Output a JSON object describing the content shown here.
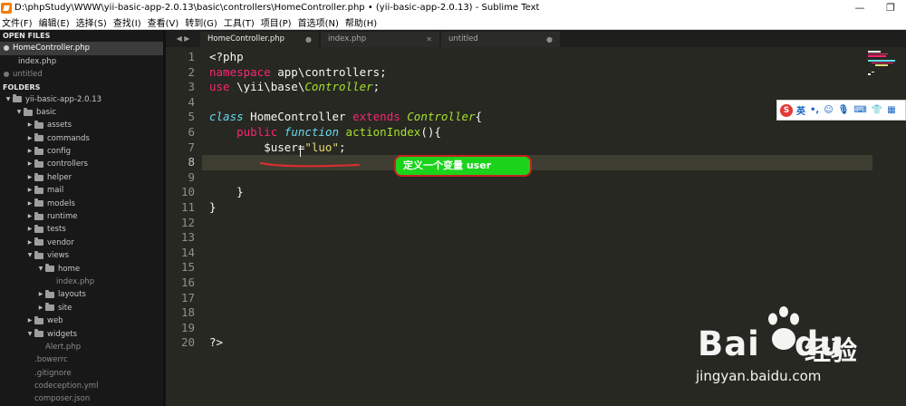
{
  "window": {
    "title": "D:\\phpStudy\\WWW\\yii-basic-app-2.0.13\\basic\\controllers\\HomeController.php • (yii-basic-app-2.0.13) - Sublime Text",
    "minimize": "—",
    "restore": "❐"
  },
  "menu": [
    "文件(F)",
    "编辑(E)",
    "选择(S)",
    "查找(I)",
    "查看(V)",
    "转到(G)",
    "工具(T)",
    "项目(P)",
    "首选项(N)",
    "帮助(H)"
  ],
  "sidebar": {
    "open_files_header": "OPEN FILES",
    "open_files": [
      {
        "label": "HomeController.php",
        "dirty": true,
        "active": true
      },
      {
        "label": "index.php",
        "dirty": false,
        "active": false
      },
      {
        "label": "untitled",
        "dirty": true,
        "active": false
      }
    ],
    "folders_header": "FOLDERS",
    "tree": [
      {
        "label": "yii-basic-app-2.0.13",
        "depth": 0,
        "type": "folder",
        "open": true
      },
      {
        "label": "basic",
        "depth": 1,
        "type": "folder",
        "open": true
      },
      {
        "label": "assets",
        "depth": 2,
        "type": "folder",
        "open": false
      },
      {
        "label": "commands",
        "depth": 2,
        "type": "folder",
        "open": false
      },
      {
        "label": "config",
        "depth": 2,
        "type": "folder",
        "open": false
      },
      {
        "label": "controllers",
        "depth": 2,
        "type": "folder",
        "open": false
      },
      {
        "label": "helper",
        "depth": 2,
        "type": "folder",
        "open": false
      },
      {
        "label": "mail",
        "depth": 2,
        "type": "folder",
        "open": false
      },
      {
        "label": "models",
        "depth": 2,
        "type": "folder",
        "open": false
      },
      {
        "label": "runtime",
        "depth": 2,
        "type": "folder",
        "open": false
      },
      {
        "label": "tests",
        "depth": 2,
        "type": "folder",
        "open": false
      },
      {
        "label": "vendor",
        "depth": 2,
        "type": "folder",
        "open": false
      },
      {
        "label": "views",
        "depth": 2,
        "type": "folder",
        "open": true
      },
      {
        "label": "home",
        "depth": 3,
        "type": "folder",
        "open": true
      },
      {
        "label": "index.php",
        "depth": 4,
        "type": "file"
      },
      {
        "label": "layouts",
        "depth": 3,
        "type": "folder",
        "open": false
      },
      {
        "label": "site",
        "depth": 3,
        "type": "folder",
        "open": false
      },
      {
        "label": "web",
        "depth": 2,
        "type": "folder",
        "open": false
      },
      {
        "label": "widgets",
        "depth": 2,
        "type": "folder",
        "open": true
      },
      {
        "label": "Alert.php",
        "depth": 3,
        "type": "file"
      },
      {
        "label": ".bowerrc",
        "depth": 2,
        "type": "file"
      },
      {
        "label": ".gitignore",
        "depth": 2,
        "type": "file"
      },
      {
        "label": "codeception.yml",
        "depth": 2,
        "type": "file"
      },
      {
        "label": "composer.json",
        "depth": 2,
        "type": "file"
      }
    ]
  },
  "tabs": [
    {
      "label": "HomeController.php",
      "marker": "●",
      "active": true
    },
    {
      "label": "index.php",
      "marker": "✕",
      "active": false
    },
    {
      "label": "untitled",
      "marker": "●",
      "active": false
    }
  ],
  "tab_nav": "◀ ▶",
  "editor": {
    "line_numbers": [
      "1",
      "2",
      "3",
      "4",
      "5",
      "6",
      "7",
      "8",
      "9",
      "10",
      "11",
      "12",
      "13",
      "14",
      "15",
      "16",
      "17",
      "18",
      "19",
      "20"
    ],
    "current_line": 8,
    "lines": [
      [
        {
          "t": "<?php",
          "c": "plain"
        }
      ],
      [
        {
          "t": "namespace",
          "c": "kw"
        },
        {
          "t": " app\\controllers;",
          "c": "plain"
        }
      ],
      [
        {
          "t": "use",
          "c": "kw"
        },
        {
          "t": " \\yii\\base\\",
          "c": "plain"
        },
        {
          "t": "Controller",
          "c": "cls"
        },
        {
          "t": ";",
          "c": "plain"
        }
      ],
      [],
      [
        {
          "t": "class",
          "c": "kwi"
        },
        {
          "t": " HomeController ",
          "c": "plain"
        },
        {
          "t": "extends",
          "c": "kw"
        },
        {
          "t": " ",
          "c": "plain"
        },
        {
          "t": "Controller",
          "c": "cls"
        },
        {
          "t": "{",
          "c": "plain"
        }
      ],
      [
        {
          "t": "    ",
          "c": "plain"
        },
        {
          "t": "public",
          "c": "kw"
        },
        {
          "t": " ",
          "c": "plain"
        },
        {
          "t": "function",
          "c": "kwi"
        },
        {
          "t": " ",
          "c": "plain"
        },
        {
          "t": "actionIndex",
          "c": "fn"
        },
        {
          "t": "(){",
          "c": "plain"
        }
      ],
      [
        {
          "t": "        $user=",
          "c": "plain"
        },
        {
          "t": "\"luo\"",
          "c": "str"
        },
        {
          "t": ";",
          "c": "plain"
        }
      ],
      [],
      [],
      [
        {
          "t": "    }",
          "c": "plain"
        }
      ],
      [
        {
          "t": "}",
          "c": "plain"
        }
      ],
      [],
      [],
      [],
      [],
      [],
      [],
      [],
      [],
      [
        {
          "t": "?>",
          "c": "plain"
        }
      ]
    ]
  },
  "annotation": {
    "callout_text": "定义一个变量 user",
    "callout_bg": "#1bd31b",
    "callout_border": "#c62020",
    "underline_color": "#d32f2f"
  },
  "ime": {
    "logo": "S",
    "lang": "英",
    "icons": [
      "punct-icon",
      "emoji-icon",
      "mic-icon",
      "keyboard-icon",
      "skin-icon",
      "toolbox-icon"
    ]
  },
  "watermark": {
    "brand": "Bai",
    "brand2": "du",
    "cn": "经验",
    "url": "jingyan.baidu.com"
  },
  "colors": {
    "editor_bg": "#272822",
    "keyword": "#f92672",
    "storage": "#66d9ef",
    "entity": "#a6e22e",
    "string": "#e6db74"
  }
}
